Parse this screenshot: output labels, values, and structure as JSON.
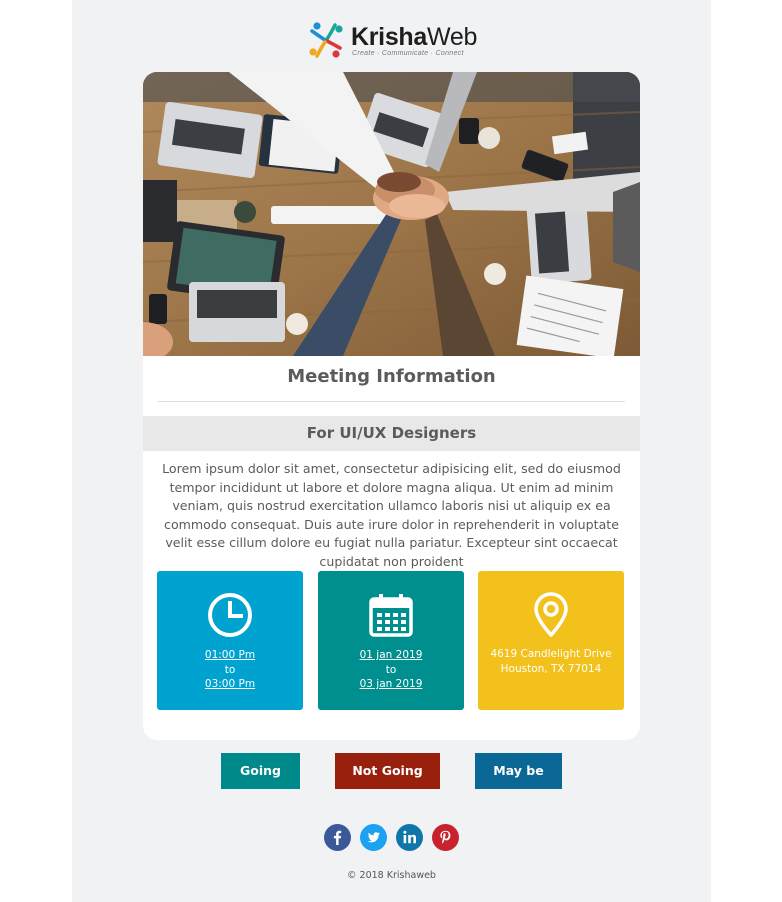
{
  "brand": {
    "name_bold": "Krisha",
    "name_light": "Web",
    "tagline": "Create · Communicate · Connect"
  },
  "hero": {
    "image_alt": "Team stacking hands over a desk with laptops"
  },
  "meeting": {
    "title": "Meeting Information",
    "audience": "For UI/UX Designers",
    "description": "Lorem ipsum dolor sit amet, consectetur adipisicing elit, sed do eiusmod tempor incididunt ut labore et dolore magna aliqua. Ut enim ad minim veniam, quis nostrud exercitation ullamco laboris nisi ut aliquip ex ea commodo consequat. Duis aute irure dolor in reprehenderit in voluptate velit esse cillum dolore eu fugiat nulla pariatur. Excepteur sint occaecat cupidatat non proident"
  },
  "time": {
    "icon": "clock-icon",
    "start": "01:00 Pm",
    "connector": "to",
    "end": "03:00 Pm",
    "color": "#00a3d0"
  },
  "date": {
    "icon": "calendar-icon",
    "start": "01 jan 2019",
    "connector": "to",
    "end": "03 jan 2019",
    "color": "#008f8f"
  },
  "location": {
    "icon": "map-pin-icon",
    "line1": "4619 Candlelight Drive",
    "line2": "Houston, TX 77014",
    "color": "#f3c11b"
  },
  "rsvp": {
    "going": "Going",
    "not_going": "Not Going",
    "maybe": "May be"
  },
  "social": [
    "facebook-icon",
    "twitter-icon",
    "linkedin-icon",
    "pinterest-icon"
  ],
  "footer": {
    "copyright": "© 2018 Krishaweb"
  }
}
